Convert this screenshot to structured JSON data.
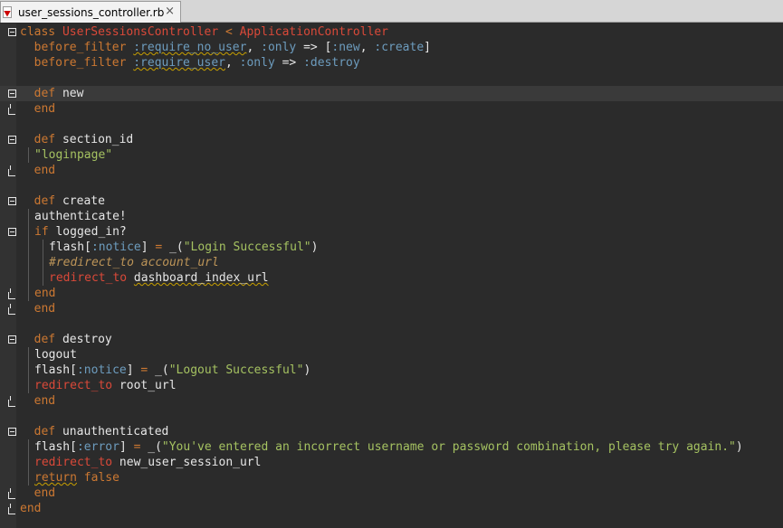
{
  "tab": {
    "filename": "user_sessions_controller.rb",
    "close_glyph": "×"
  },
  "colors": {
    "background": "#2b2b2b",
    "keyword": "#cc7832",
    "class_name": "#da4939",
    "symbol": "#6d9cbe",
    "string": "#a5c261",
    "comment": "#bc9458",
    "text": "#e6e6e6"
  },
  "editor": {
    "current_line": 5,
    "lines": [
      {
        "fold": "start",
        "indent": 0,
        "tokens": [
          {
            "c": "t-kw",
            "t": "class "
          },
          {
            "c": "t-cls",
            "t": "UserSessionsController"
          },
          {
            "c": "t-text",
            "t": " "
          },
          {
            "c": "t-kw",
            "t": "<"
          },
          {
            "c": "t-text",
            "t": " "
          },
          {
            "c": "t-cls",
            "t": "ApplicationController"
          }
        ]
      },
      {
        "fold": "",
        "indent": 0,
        "tokens": [
          {
            "c": "t-text",
            "t": "  "
          },
          {
            "c": "t-kw",
            "t": "before_filter"
          },
          {
            "c": "t-text",
            "t": " "
          },
          {
            "c": "t-sym squig",
            "t": ":require_no_user"
          },
          {
            "c": "t-text",
            "t": ", "
          },
          {
            "c": "t-sym",
            "t": ":only"
          },
          {
            "c": "t-text",
            "t": " => ["
          },
          {
            "c": "t-sym",
            "t": ":new"
          },
          {
            "c": "t-text",
            "t": ", "
          },
          {
            "c": "t-sym",
            "t": ":create"
          },
          {
            "c": "t-text",
            "t": "]"
          }
        ]
      },
      {
        "fold": "",
        "indent": 0,
        "tokens": [
          {
            "c": "t-text",
            "t": "  "
          },
          {
            "c": "t-kw",
            "t": "before_filter"
          },
          {
            "c": "t-text",
            "t": " "
          },
          {
            "c": "t-sym squig",
            "t": ":require_user"
          },
          {
            "c": "t-text",
            "t": ", "
          },
          {
            "c": "t-sym",
            "t": ":only"
          },
          {
            "c": "t-text",
            "t": " => "
          },
          {
            "c": "t-sym",
            "t": ":destroy"
          }
        ]
      },
      {
        "fold": "",
        "indent": 0,
        "tokens": []
      },
      {
        "fold": "start",
        "indent": 0,
        "tokens": [
          {
            "c": "t-text",
            "t": "  "
          },
          {
            "c": "t-kw",
            "t": "def"
          },
          {
            "c": "t-text",
            "t": " new"
          }
        ]
      },
      {
        "fold": "end",
        "indent": 0,
        "tokens": [
          {
            "c": "t-text",
            "t": "  "
          },
          {
            "c": "t-kw",
            "t": "end"
          }
        ]
      },
      {
        "fold": "",
        "indent": 0,
        "tokens": []
      },
      {
        "fold": "start",
        "indent": 0,
        "tokens": [
          {
            "c": "t-text",
            "t": "  "
          },
          {
            "c": "t-kw",
            "t": "def"
          },
          {
            "c": "t-text",
            "t": " section_id"
          }
        ]
      },
      {
        "fold": "",
        "indent": 1,
        "tokens": [
          {
            "c": "t-str",
            "t": "\"loginpage\""
          }
        ]
      },
      {
        "fold": "end",
        "indent": 0,
        "tokens": [
          {
            "c": "t-text",
            "t": "  "
          },
          {
            "c": "t-kw",
            "t": "end"
          }
        ]
      },
      {
        "fold": "",
        "indent": 0,
        "tokens": []
      },
      {
        "fold": "start",
        "indent": 0,
        "tokens": [
          {
            "c": "t-text",
            "t": "  "
          },
          {
            "c": "t-kw",
            "t": "def"
          },
          {
            "c": "t-text",
            "t": " create"
          }
        ]
      },
      {
        "fold": "",
        "indent": 1,
        "tokens": [
          {
            "c": "t-text",
            "t": "authenticate!"
          }
        ]
      },
      {
        "fold": "start",
        "indent": 1,
        "tokens": [
          {
            "c": "t-kw",
            "t": "if"
          },
          {
            "c": "t-text",
            "t": " logged_in?"
          }
        ]
      },
      {
        "fold": "",
        "indent": 2,
        "tokens": [
          {
            "c": "t-text",
            "t": "flash["
          },
          {
            "c": "t-sym",
            "t": ":notice"
          },
          {
            "c": "t-text",
            "t": "] "
          },
          {
            "c": "t-kw",
            "t": "="
          },
          {
            "c": "t-text",
            "t": " _("
          },
          {
            "c": "t-str",
            "t": "\"Login Successful\""
          },
          {
            "c": "t-text",
            "t": ")"
          }
        ]
      },
      {
        "fold": "",
        "indent": 2,
        "tokens": [
          {
            "c": "t-cmt",
            "t": "#redirect_to account_url"
          }
        ]
      },
      {
        "fold": "",
        "indent": 2,
        "tokens": [
          {
            "c": "t-red",
            "t": "redirect_to"
          },
          {
            "c": "t-text",
            "t": " "
          },
          {
            "c": "t-text squig",
            "t": "dashboard_index_url"
          }
        ]
      },
      {
        "fold": "end",
        "indent": 1,
        "tokens": [
          {
            "c": "t-kw",
            "t": "end"
          }
        ]
      },
      {
        "fold": "end",
        "indent": 0,
        "tokens": [
          {
            "c": "t-text",
            "t": "  "
          },
          {
            "c": "t-kw",
            "t": "end"
          }
        ]
      },
      {
        "fold": "",
        "indent": 0,
        "tokens": []
      },
      {
        "fold": "start",
        "indent": 0,
        "tokens": [
          {
            "c": "t-text",
            "t": "  "
          },
          {
            "c": "t-kw",
            "t": "def"
          },
          {
            "c": "t-text",
            "t": " destroy"
          }
        ]
      },
      {
        "fold": "",
        "indent": 1,
        "tokens": [
          {
            "c": "t-text",
            "t": "logout"
          }
        ]
      },
      {
        "fold": "",
        "indent": 1,
        "tokens": [
          {
            "c": "t-text",
            "t": "flash["
          },
          {
            "c": "t-sym",
            "t": ":notice"
          },
          {
            "c": "t-text",
            "t": "] "
          },
          {
            "c": "t-kw",
            "t": "="
          },
          {
            "c": "t-text",
            "t": " _("
          },
          {
            "c": "t-str",
            "t": "\"Logout Successful\""
          },
          {
            "c": "t-text",
            "t": ")"
          }
        ]
      },
      {
        "fold": "",
        "indent": 1,
        "tokens": [
          {
            "c": "t-red",
            "t": "redirect_to"
          },
          {
            "c": "t-text",
            "t": " root_url"
          }
        ]
      },
      {
        "fold": "end",
        "indent": 0,
        "tokens": [
          {
            "c": "t-text",
            "t": "  "
          },
          {
            "c": "t-kw",
            "t": "end"
          }
        ]
      },
      {
        "fold": "",
        "indent": 0,
        "tokens": []
      },
      {
        "fold": "start",
        "indent": 0,
        "tokens": [
          {
            "c": "t-text",
            "t": "  "
          },
          {
            "c": "t-kw",
            "t": "def"
          },
          {
            "c": "t-text",
            "t": " unauthenticated"
          }
        ]
      },
      {
        "fold": "",
        "indent": 1,
        "tokens": [
          {
            "c": "t-text",
            "t": "flash["
          },
          {
            "c": "t-sym",
            "t": ":error"
          },
          {
            "c": "t-text",
            "t": "] "
          },
          {
            "c": "t-kw",
            "t": "="
          },
          {
            "c": "t-text",
            "t": " _("
          },
          {
            "c": "t-str",
            "t": "\"You've entered an incorrect username or password combination, please try again.\""
          },
          {
            "c": "t-text",
            "t": ")"
          }
        ]
      },
      {
        "fold": "",
        "indent": 1,
        "tokens": [
          {
            "c": "t-red",
            "t": "redirect_to"
          },
          {
            "c": "t-text",
            "t": " new_user_session_url"
          }
        ]
      },
      {
        "fold": "",
        "indent": 1,
        "tokens": [
          {
            "c": "t-kw squig",
            "t": "return"
          },
          {
            "c": "t-text",
            "t": " "
          },
          {
            "c": "t-kw",
            "t": "false"
          }
        ]
      },
      {
        "fold": "end",
        "indent": 0,
        "tokens": [
          {
            "c": "t-text",
            "t": "  "
          },
          {
            "c": "t-kw",
            "t": "end"
          }
        ]
      },
      {
        "fold": "end",
        "indent": 0,
        "tokens": [
          {
            "c": "t-kw",
            "t": "end"
          }
        ]
      }
    ]
  }
}
